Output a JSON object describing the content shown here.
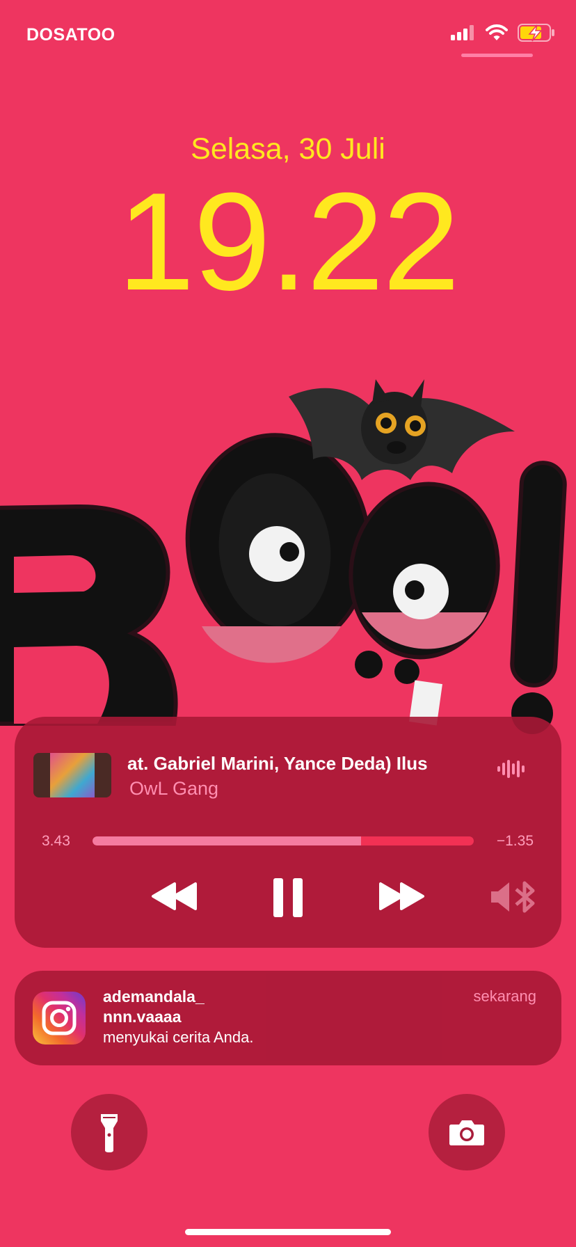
{
  "status_bar": {
    "carrier": "DOSATOO",
    "signal_icon": "signal-bars-icon",
    "wifi_icon": "wifi-icon",
    "battery_icon": "battery-charging-icon",
    "battery_color": "#ffd60a"
  },
  "lock_screen": {
    "date": "Selasa, 30 Juli",
    "time": "19.22",
    "accent_color": "#ffe81f",
    "background_color": "#ee3560"
  },
  "now_playing": {
    "title": "at. Gabriel Marini, Yance Deda)      Ilus",
    "artist": "OwL Gang",
    "elapsed": "3.43",
    "remaining": "−1.35",
    "progress_fraction": 0.705,
    "controls": {
      "rewind_icon": "rewind-icon",
      "pause_icon": "pause-icon",
      "forward_icon": "fast-forward-icon",
      "output_icon": "speaker-bluetooth-icon"
    }
  },
  "notification": {
    "app_icon": "instagram-icon",
    "title": "ademandala_",
    "subtitle": "nnn.vaaaa",
    "body": "menyukai cerita Anda.",
    "time": "sekarang"
  },
  "quick_actions": {
    "left_icon": "flashlight-icon",
    "right_icon": "camera-icon"
  }
}
